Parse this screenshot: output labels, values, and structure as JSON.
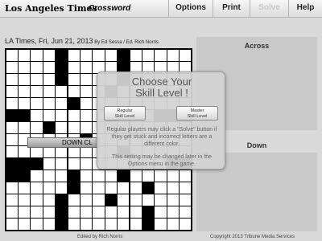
{
  "header": {
    "logo": "Los Angeles Times",
    "subtitle": "Crossword",
    "nav": [
      {
        "label": "Options",
        "disabled": false
      },
      {
        "label": "Print",
        "disabled": false
      },
      {
        "label": "Solve",
        "disabled": true
      },
      {
        "label": "Help",
        "disabled": false
      }
    ]
  },
  "puzzle": {
    "title": "LA Times, Fri, Jun 21, 2013",
    "byline": " By Ed Sessa / Ed. Rich Norris",
    "active_clue": "DOWN CL"
  },
  "grid": {
    "size": 15,
    "rows": [
      "....#....#.....",
      "....#....#.....",
      "....#....#.....",
      "........#......",
      ".....#.........",
      "##......#...###",
      "...#...........",
      "......#........",
      ".........#.....",
      "###..........##",
      "##...#...#.....",
      ".....#.....#...",
      "....#...#......",
      "....#......#...",
      "....#......#..."
    ]
  },
  "panels": {
    "across_title": "Across",
    "down_title": "Down"
  },
  "modal": {
    "title_line1": "Choose Your",
    "title_line2": "Skill Level !",
    "regular_line1": "Regular",
    "regular_line2": "Skill Level",
    "master_line1": "Master",
    "master_line2": "Skill Level",
    "description": "Regular players may click a \"Solve\" button if they get stuck and incorrect letters are a different color.",
    "note": "This setting may be changed later in the Options menu in the game."
  },
  "footer": {
    "left": "Edited by Rich Norris",
    "right": "Copyright 2013 Tribune Media Services"
  }
}
